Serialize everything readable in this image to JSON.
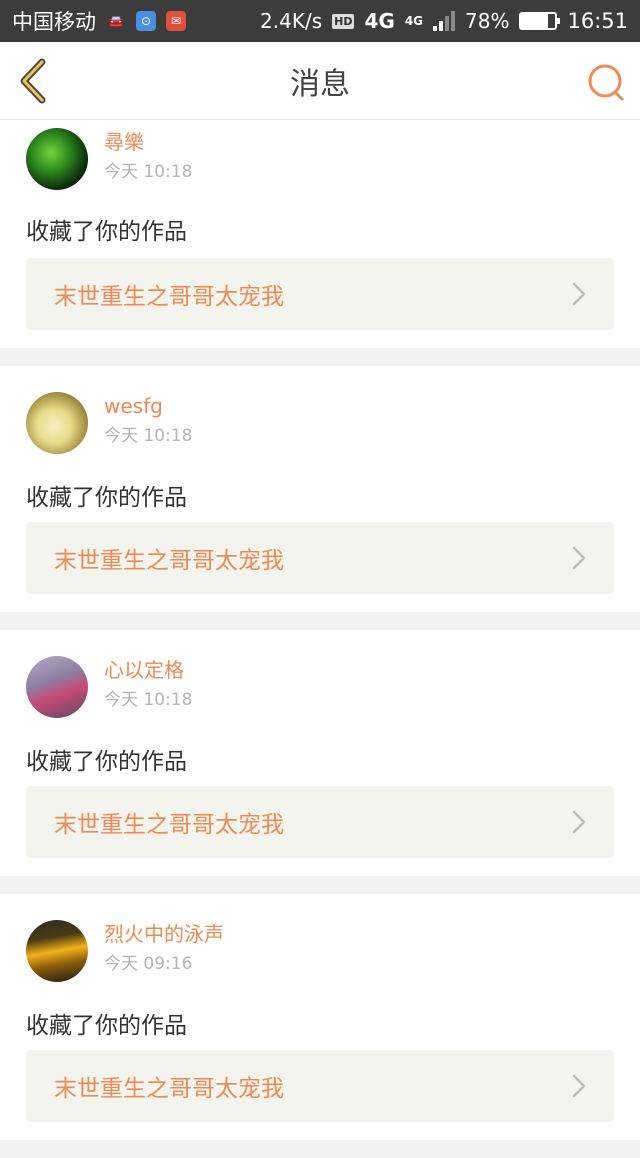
{
  "status_bar": {
    "carrier": "中国移动",
    "speed": "2.4K/s",
    "hd": "HD",
    "network1": "4G",
    "network2": "4G",
    "battery": "78%",
    "battery_level": 0.78,
    "time": "16:51"
  },
  "nav": {
    "title": "消息",
    "back_icon": "back-chevron-icon",
    "search_icon": "search-icon",
    "accent_color": "#ef8a54"
  },
  "messages": [
    {
      "user": "尋樂",
      "time": "今天 10:18",
      "action": "收藏了你的作品",
      "work": "末世重生之哥哥太宠我"
    },
    {
      "user": "wesfg",
      "time": "今天 10:18",
      "action": "收藏了你的作品",
      "work": "末世重生之哥哥太宠我"
    },
    {
      "user": "心以定格",
      "time": "今天 10:18",
      "action": "收藏了你的作品",
      "work": "末世重生之哥哥太宠我"
    },
    {
      "user": "烈火中的泳声",
      "time": "今天 09:16",
      "action": "收藏了你的作品",
      "work": "末世重生之哥哥太宠我"
    }
  ]
}
